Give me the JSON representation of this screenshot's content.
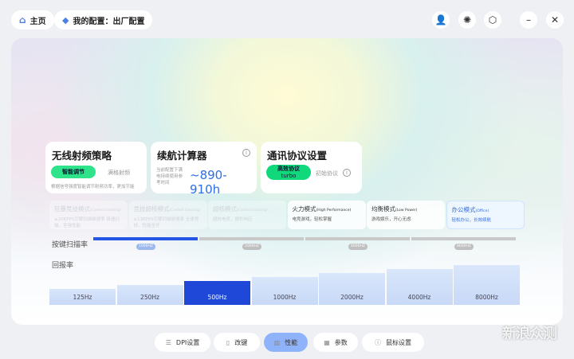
{
  "topbar": {
    "home": "主页",
    "config": "我的配置：出厂配置"
  },
  "cards": {
    "rf": {
      "title": "无线射频策略",
      "active": "智能调节",
      "alt": "满格射频",
      "desc": "根据信号强度智能调节射频功率，更加节能"
    },
    "battery": {
      "title": "续航计算器",
      "desc": "当前配置下满电持续使用参考时间",
      "value": "~890-910h"
    },
    "protocol": {
      "title": "通讯协议设置",
      "active_line1": "高效协议",
      "active_line2": "turbo",
      "alt": "初始协议"
    }
  },
  "modes": [
    {
      "title": "狂暴竞技模式",
      "en": "(Corded Gaming)",
      "desc": "≥20KFPS引擎扫描帧速率 极速扫描，至强性能",
      "state": "disabled"
    },
    {
      "title": "竞技超核模式",
      "en": "(Corded Gaming)",
      "desc": "≥13KFPS引擎扫描帧速率 全速竞技，性能全开",
      "state": "disabled"
    },
    {
      "title": "超核模式",
      "en": "(Corded Gaming)",
      "desc": "超核电竞，微秒响应",
      "state": "disabled"
    },
    {
      "title": "火力模式",
      "en": "(High Performance)",
      "desc": "电竞游戏，轻松掌握",
      "state": "enabled"
    },
    {
      "title": "均衡模式",
      "en": "(Low Power)",
      "desc": "游戏娱乐，开心无虑",
      "state": "enabled"
    },
    {
      "title": "办公模式",
      "en": "(Office)",
      "desc": "轻松办公，长效续航",
      "state": "selected"
    }
  ],
  "scan_rate": {
    "label": "按键扫描率",
    "options": [
      "1000HZ",
      "2000HZ",
      "4000HZ",
      "8000HZ"
    ],
    "selected_index": 0
  },
  "report_rate": {
    "label": "回报率",
    "options": [
      "125Hz",
      "250Hz",
      "500Hz",
      "1000Hz",
      "2000Hz",
      "4000Hz",
      "8000Hz"
    ],
    "selected_index": 2
  },
  "bottom_nav": [
    "DPI设置",
    "改键",
    "性能",
    "参数",
    "鼠标设置"
  ],
  "watermark": "新浪众测",
  "colors": {
    "accent": "#1f47d8",
    "green": "#2ee38a",
    "nav_selected": "#8eb3fb"
  }
}
